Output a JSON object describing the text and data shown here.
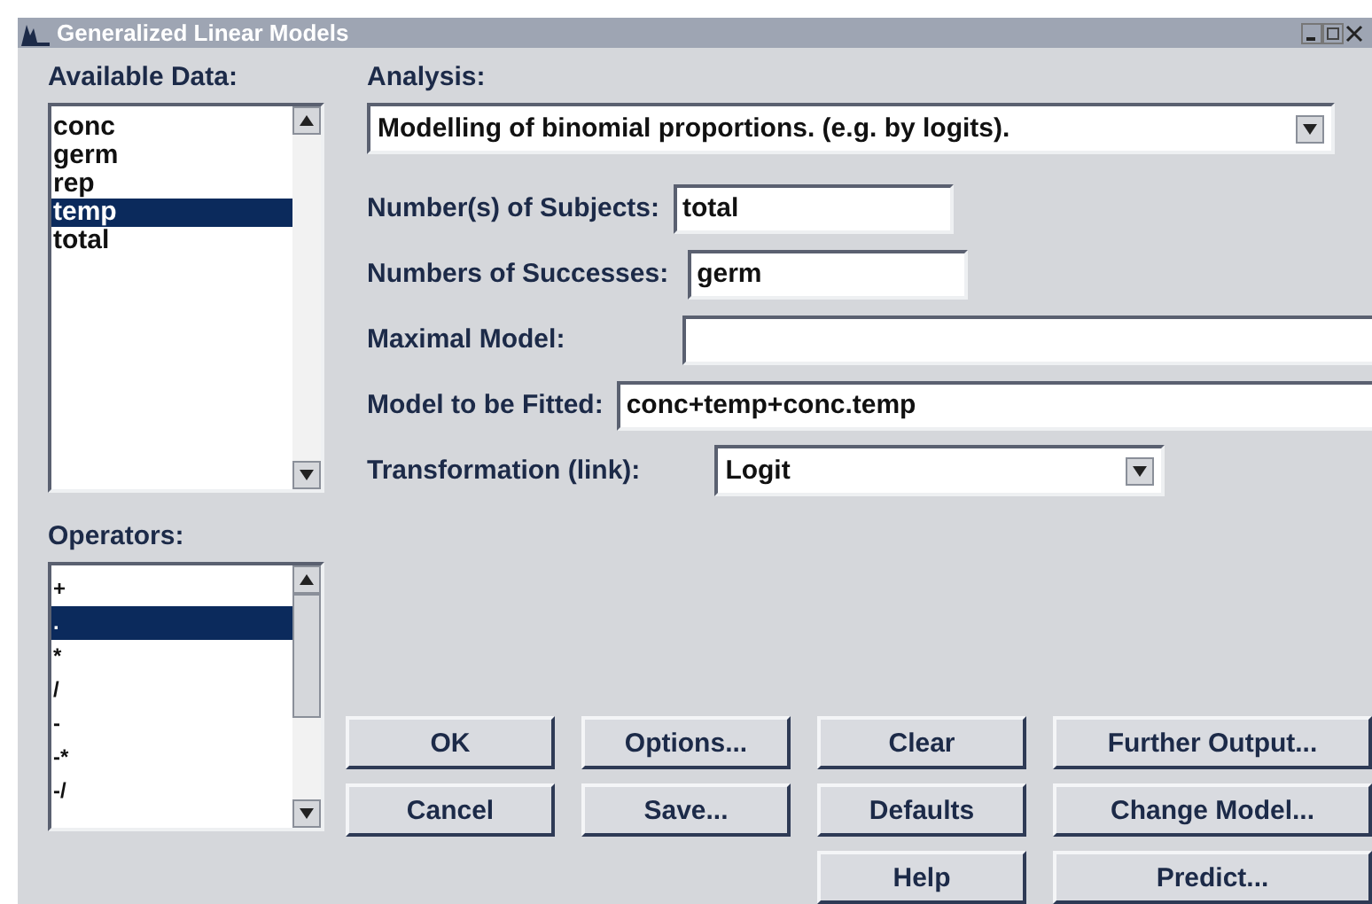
{
  "window": {
    "title": "Generalized Linear Models"
  },
  "available_data": {
    "label": "Available Data:",
    "items": [
      {
        "label": "conc",
        "selected": false
      },
      {
        "label": "germ",
        "selected": false
      },
      {
        "label": "rep",
        "selected": false
      },
      {
        "label": "temp",
        "selected": true
      },
      {
        "label": "total",
        "selected": false
      }
    ]
  },
  "analysis": {
    "label": "Analysis:",
    "value": "Modelling of binomial proportions. (e.g. by logits)."
  },
  "fields": [
    {
      "kind": "short",
      "label": "Number(s) of Subjects:",
      "value": "total"
    },
    {
      "kind": "short",
      "label": "Numbers of Successes:",
      "value": "germ"
    },
    {
      "kind": "wide",
      "label": "Maximal Model:"
    },
    {
      "kind": "wide",
      "label": "Model to be Fitted:",
      "value": "conc+temp+conc.temp"
    },
    {
      "kind": "select",
      "label": "Transformation (link):",
      "value": "Logit"
    }
  ],
  "operators": {
    "label": "Operators:",
    "items": [
      {
        "label": "+",
        "selected": false
      },
      {
        "label": ".",
        "selected": true
      },
      {
        "label": "*",
        "selected": false
      },
      {
        "label": "/",
        "selected": false
      },
      {
        "label": "-",
        "selected": false
      },
      {
        "label": "-*",
        "selected": false
      },
      {
        "label": "-/",
        "selected": false
      }
    ]
  },
  "button_columns": [
    [
      "OK",
      "Cancel"
    ],
    [
      "Options...",
      "Save..."
    ],
    [
      "Clear",
      "Defaults",
      "Help"
    ],
    [
      "Further Output...",
      "Change Model...",
      "Predict..."
    ]
  ]
}
